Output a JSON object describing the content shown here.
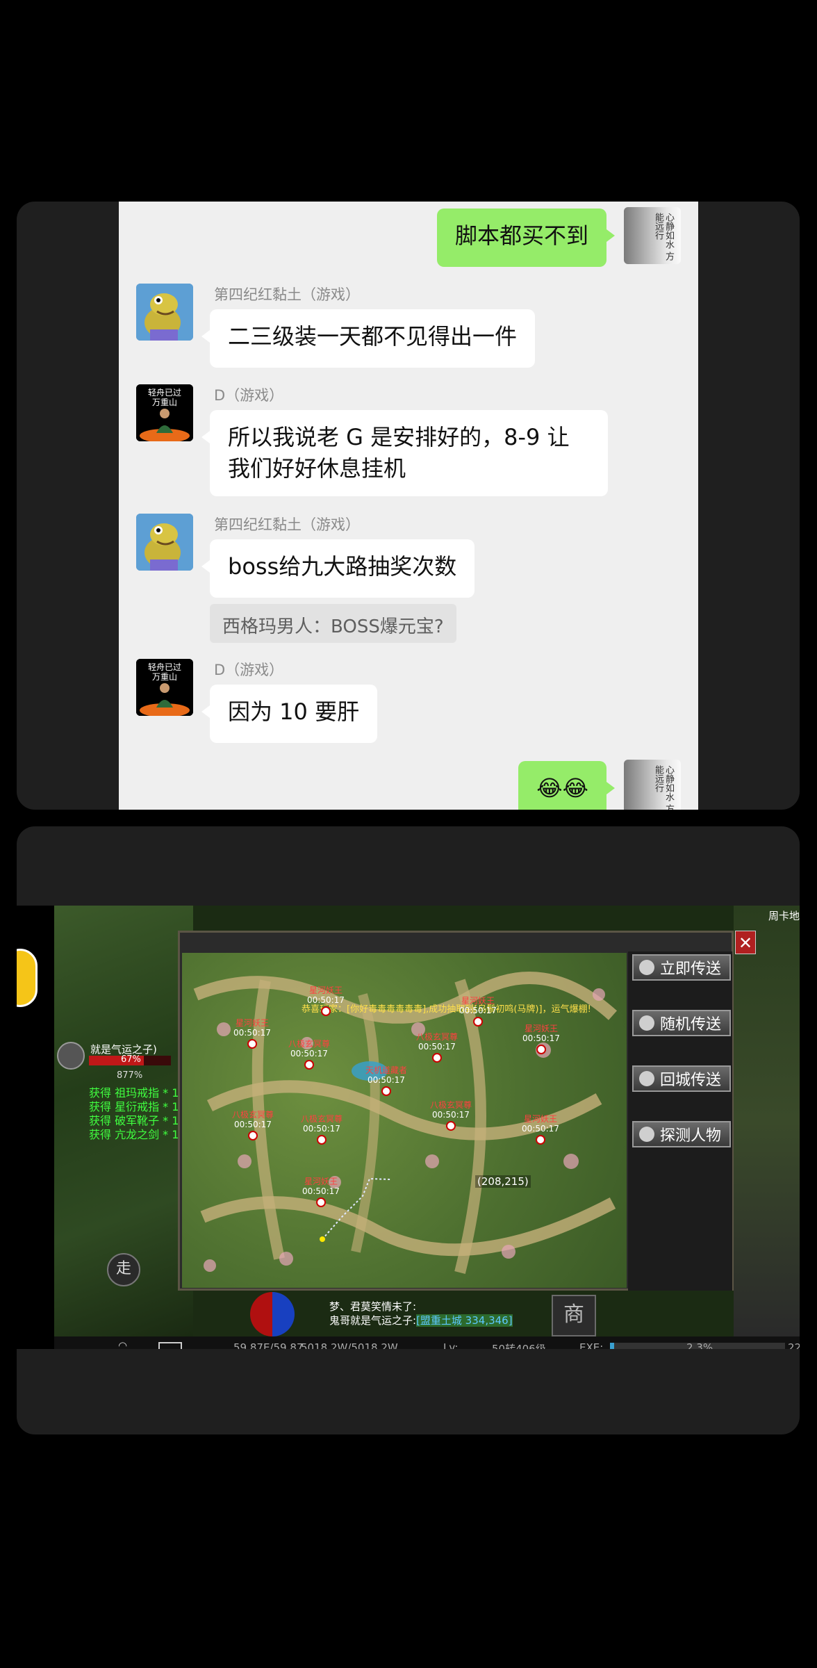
{
  "chat": {
    "me_avatar_text": "心静如水 方能远行",
    "messages": [
      {
        "sender": "",
        "text": "脚本都买不到"
      },
      {
        "sender": "第四纪红黏土（游戏）",
        "text": "二三级装一天都不见得出一件"
      },
      {
        "sender": "D（游戏）",
        "text": "所以我说老 G 是安排好的，8-9 让我们好好休息挂机"
      },
      {
        "sender": "第四纪红黏土（游戏）",
        "text": "boss给九大路抽奖次数"
      },
      {
        "quote": "西格玛男人：BOSS爆元宝?"
      },
      {
        "sender": "D（游戏）",
        "text": "因为 10 要肝"
      },
      {
        "sender": "",
        "text": "😂😂"
      }
    ],
    "d_avatar_text": "轻舟已过万重山"
  },
  "game": {
    "buttons": [
      "立即传送",
      "随机传送",
      "回城传送",
      "探测人物"
    ],
    "close_label": "✕",
    "notice": "恭喜玩家：[你好毒毒毒毒毒毒],成功抽取到[乌鬃初鸣(马牌)]，运气爆棚!",
    "coord": "(208,215)",
    "markers": [
      {
        "name": "星河妖王",
        "time": "00:50:17"
      },
      {
        "name": "星河妖王",
        "time": "00:50:17"
      },
      {
        "name": "星河妖王",
        "time": "00:50:17"
      },
      {
        "name": "星河妖王",
        "time": "00:50:17"
      },
      {
        "name": "八极玄冥尊",
        "time": "00:50:17"
      },
      {
        "name": "八极玄冥尊",
        "time": "00:50:17"
      },
      {
        "name": "天机道藏者",
        "time": "00:50:17"
      },
      {
        "name": "八极玄冥尊",
        "time": "00:50:17"
      },
      {
        "name": "八极玄冥尊",
        "time": "00:50:17"
      },
      {
        "name": "星河妖王",
        "time": "00:50:17"
      },
      {
        "name": "八极玄冥尊",
        "time": "00:50:17"
      },
      {
        "name": "星河妖王",
        "time": "00:50:17"
      }
    ],
    "left_title": "就是气运之子)",
    "left_pct": "67%",
    "left_pct2": "877%",
    "loot": [
      "获得 祖玛戒指 * 1",
      "获得 星衍戒指 * 1",
      "获得 破军靴子 * 1",
      "获得 亢龙之剑 * 1"
    ],
    "chat_lines": [
      "梦、君莫笑情未了:",
      "鬼哥就是气运之子:"
    ],
    "chat_tag": "[盟重土城 334,346]",
    "shop_label": "商",
    "walk_label": "走",
    "right_label": "周卡地",
    "bottom": {
      "hp": "59.87E/59.87",
      "mp": "5018.2W/5018.2W",
      "lv_label": "Lv:",
      "lv": "50转406级",
      "exp_label": "EXE:",
      "exp": "2.3%",
      "tail": "22"
    }
  }
}
